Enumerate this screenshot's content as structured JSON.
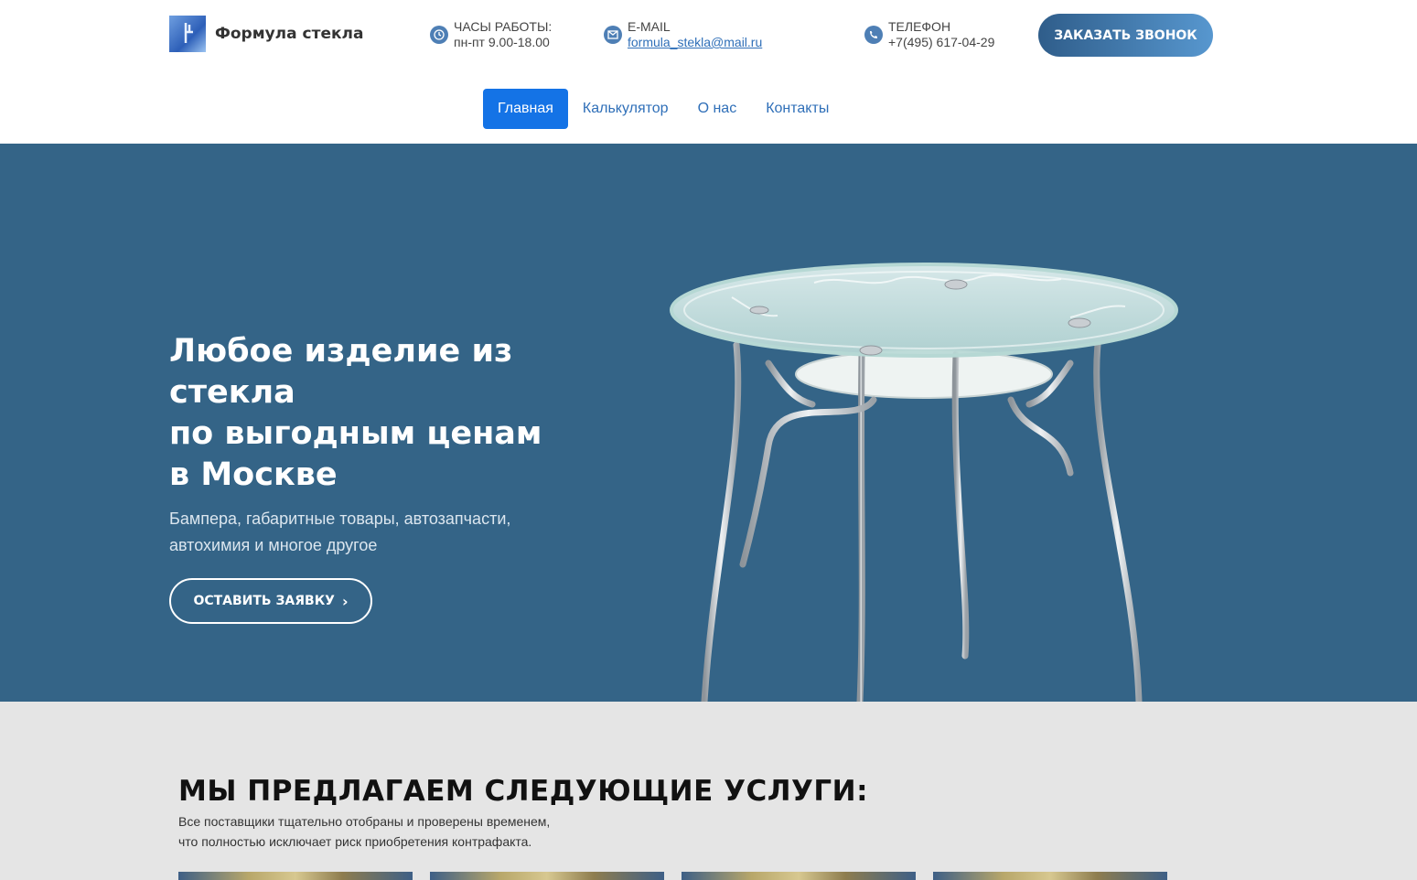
{
  "header": {
    "logo_text": "Формула стекла",
    "hours_label": "ЧАСЫ РАБОТЫ:",
    "hours_value": "пн-пт 9.00-18.00",
    "email_label": "E-MAIL",
    "email_value": "formula_stekla@mail.ru",
    "phone_label": "ТЕЛЕФОН",
    "phone_value": "+7(495) 617-04-29",
    "call_button": "ЗАКАЗАТЬ ЗВОНОК"
  },
  "nav": {
    "items": [
      {
        "label": "Главная",
        "active": true
      },
      {
        "label": "Калькулятор",
        "active": false
      },
      {
        "label": "О нас",
        "active": false
      },
      {
        "label": "Контакты",
        "active": false
      }
    ]
  },
  "hero": {
    "title_lines": [
      "Любое изделие из",
      "стекла",
      "по выгодным ценам",
      "в Москве"
    ],
    "subtitle": "Бампера, габаритные товары, автозапчасти, автохимия и многое другое",
    "cta_label": "ОСТАВИТЬ ЗАЯВКУ",
    "cta_icon": "chevron-right-icon"
  },
  "services": {
    "heading": "МЫ ПРЕДЛАГАЕМ СЛЕДУЮЩИЕ УСЛУГИ:",
    "desc_lines": [
      "Все поставщики тщательно отобраны и проверены временем,",
      "что полностью исключает риск приобретения контрафакта."
    ],
    "card_count": 4
  },
  "colors": {
    "hero_bg": "#346487",
    "accent": "#1473e6",
    "services_bg": "#e5e5e5"
  }
}
